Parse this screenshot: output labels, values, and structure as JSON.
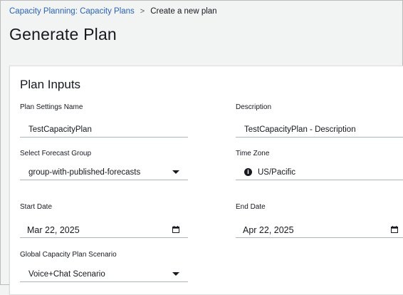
{
  "breadcrumb": {
    "parent": "Capacity Planning: Capacity Plans",
    "separator": ">",
    "current": "Create a new plan"
  },
  "page": {
    "title": "Generate Plan"
  },
  "panel": {
    "title": "Plan Inputs",
    "fields": {
      "plan_settings_name": {
        "label": "Plan Settings Name",
        "value": "TestCapacityPlan"
      },
      "description": {
        "label": "Description",
        "value": "TestCapacityPlan - Description"
      },
      "forecast_group": {
        "label": "Select Forecast Group",
        "value": "group-with-published-forecasts"
      },
      "time_zone": {
        "label": "Time Zone",
        "value": "US/Pacific",
        "icon": "info-icon"
      },
      "start_date": {
        "label": "Start Date",
        "value": "Mar 22, 2025",
        "icon": "calendar-icon"
      },
      "end_date": {
        "label": "End Date",
        "value": "Apr 22, 2025",
        "icon": "calendar-icon"
      },
      "scenario": {
        "label": "Global Capacity Plan Scenario",
        "value": "Voice+Chat Scenario"
      }
    }
  },
  "colors": {
    "link": "#2a62b8",
    "page_bg": "#f2f3f3",
    "panel_bg": "#ffffff",
    "underline": "#aab7b8"
  }
}
